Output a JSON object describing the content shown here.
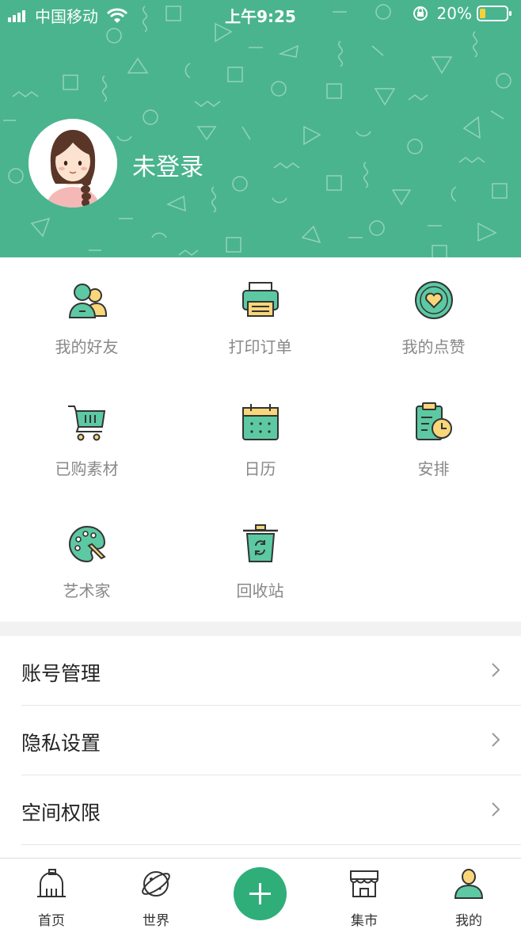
{
  "status_bar": {
    "carrier": "中国移动",
    "time": "上午9:25",
    "battery": "20%"
  },
  "profile": {
    "username": "未登录"
  },
  "features": [
    {
      "label": "我的好友",
      "icon": "friends-icon"
    },
    {
      "label": "打印订单",
      "icon": "printer-icon"
    },
    {
      "label": "我的点赞",
      "icon": "heart-icon"
    },
    {
      "label": "已购素材",
      "icon": "cart-icon"
    },
    {
      "label": "日历",
      "icon": "calendar-icon"
    },
    {
      "label": "安排",
      "icon": "schedule-icon"
    },
    {
      "label": "艺术家",
      "icon": "palette-icon"
    },
    {
      "label": "回收站",
      "icon": "recycle-bin-icon"
    }
  ],
  "settings": [
    {
      "label": "账号管理"
    },
    {
      "label": "隐私设置"
    },
    {
      "label": "空间权限"
    }
  ],
  "tabbar": {
    "items": [
      {
        "label": "首页",
        "icon": "home-icon"
      },
      {
        "label": "世界",
        "icon": "planet-icon"
      },
      {
        "label": "",
        "icon": "plus-icon"
      },
      {
        "label": "集市",
        "icon": "shop-icon"
      },
      {
        "label": "我的",
        "icon": "user-icon"
      }
    ]
  },
  "colors": {
    "brand_green": "#4ab48f",
    "accent_green": "#2fae7a",
    "icon_yellow": "#f9d679",
    "icon_teal": "#5cc9a3"
  }
}
